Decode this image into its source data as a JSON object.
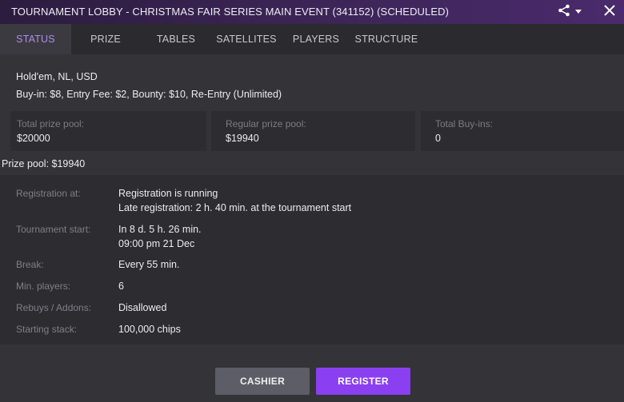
{
  "window": {
    "title": "TOURNAMENT LOBBY - CHRISTMAS FAIR SERIES MAIN EVENT (341152) (SCHEDULED)",
    "share_icon": "share-icon",
    "dropdown_icon": "caret-down-icon",
    "close_icon": "close-icon"
  },
  "tabs": [
    {
      "label": "STATUS",
      "active": true
    },
    {
      "label": "PRIZE",
      "active": false
    },
    {
      "label": "TABLES",
      "active": false
    },
    {
      "label": "SATELLITES",
      "active": false
    },
    {
      "label": "PLAYERS",
      "active": false
    },
    {
      "label": "STRUCTURE",
      "active": false
    }
  ],
  "summary": {
    "game": "Hold'em, NL, USD",
    "buyin": "Buy-in: $8, Entry Fee: $2, Bounty: $10, Re-Entry (Unlimited)"
  },
  "stats": [
    {
      "label": "Total prize pool:",
      "value": "$20000"
    },
    {
      "label": "Regular prize pool:",
      "value": "$19940"
    },
    {
      "label": "Total Buy-ins:",
      "value": "0"
    }
  ],
  "prize_pool_line": "Prize pool: $19940",
  "details": {
    "registration": {
      "label": "Registration at:",
      "line1": "Registration is running",
      "line2": "Late registration: 2 h. 40 min. at the tournament start"
    },
    "start": {
      "label": "Tournament start:",
      "line1": "In 8 d. 5 h. 26 min.",
      "line2": "09:00 pm 21 Dec"
    },
    "break": {
      "label": "Break:",
      "value": "Every 55 min."
    },
    "min_players": {
      "label": "Min. players:",
      "value": "6"
    },
    "rebuys": {
      "label": "Rebuys / Addons:",
      "value": "Disallowed"
    },
    "stack": {
      "label": "Starting stack:",
      "value": "100,000 chips"
    }
  },
  "buttons": {
    "cashier": "CASHIER",
    "register": "REGISTER"
  },
  "colors": {
    "accent": "#8a3ff0",
    "active_tab_text": "#b08af0",
    "background": "#333338"
  }
}
